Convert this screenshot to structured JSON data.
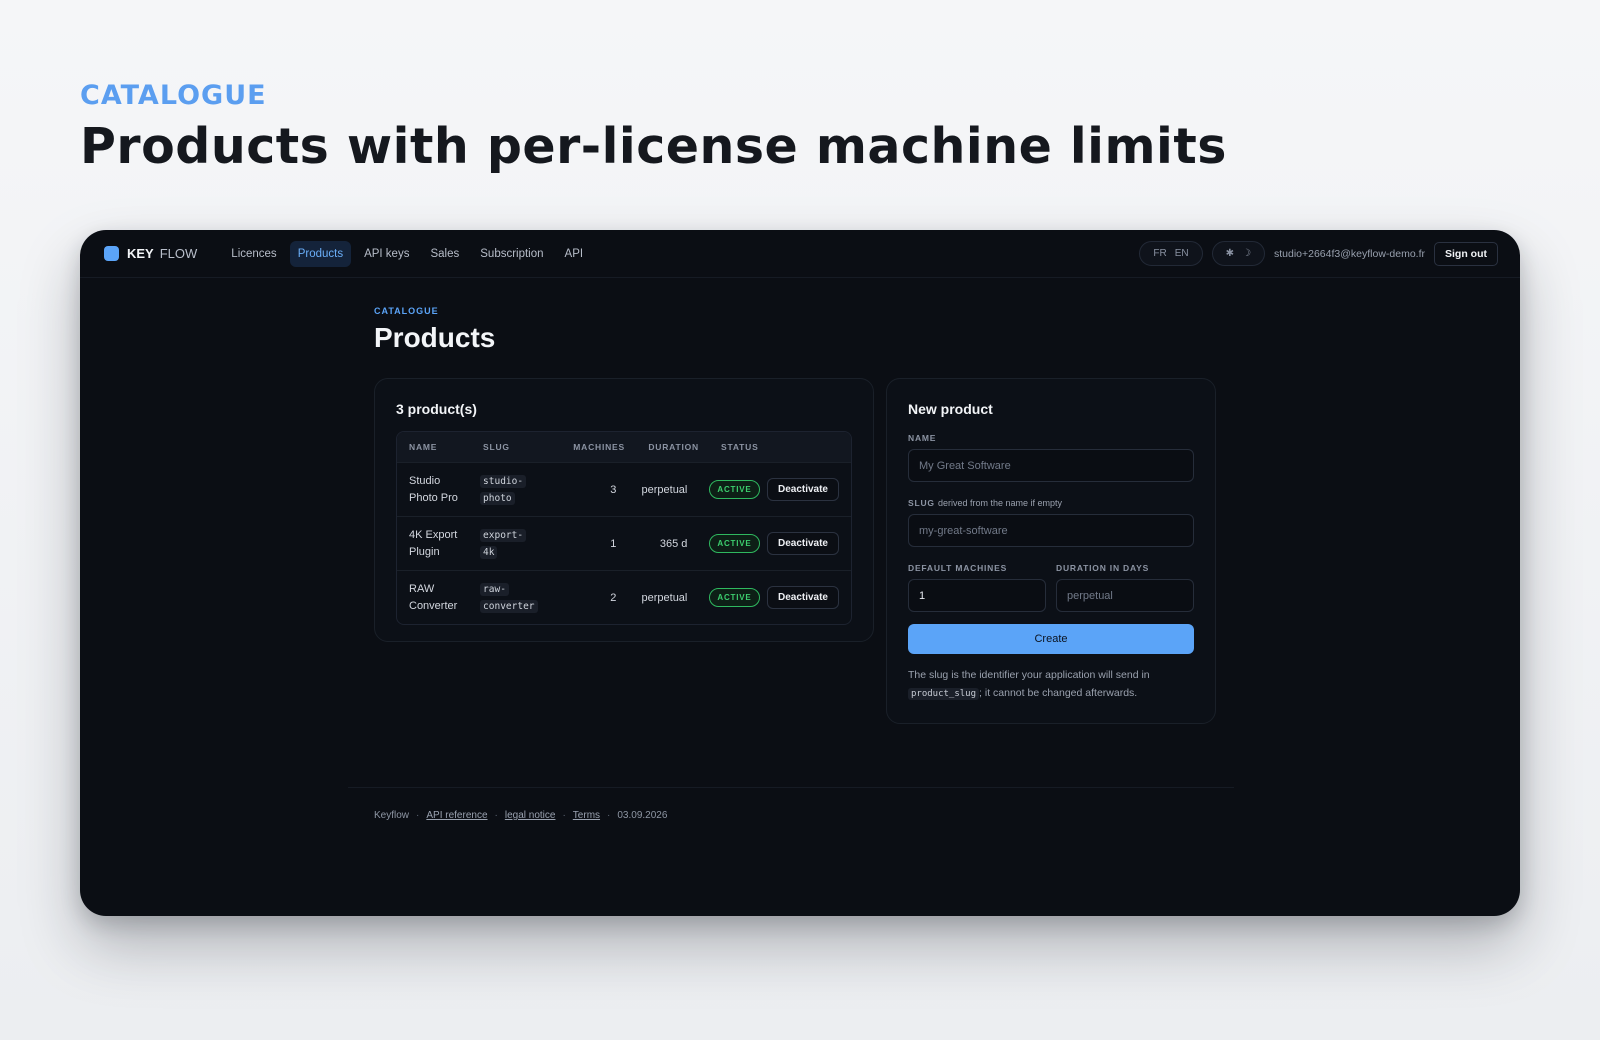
{
  "hero": {
    "eyebrow": "CATALOGUE",
    "title": "Products with per-license machine limits"
  },
  "app": {
    "logo_part1": "KEY",
    "logo_part2": "FLOW",
    "nav": [
      "Licences",
      "Products",
      "API keys",
      "Sales",
      "Subscription",
      "API"
    ],
    "active_nav": "Products",
    "lang": [
      "FR",
      "EN"
    ],
    "theme_icons": [
      "sun-icon",
      "moon-icon"
    ],
    "user_email": "studio+2664f3@keyflow-demo.fr",
    "sign_out": "Sign out"
  },
  "page": {
    "eyebrow": "CATALOGUE",
    "title": "Products"
  },
  "products": {
    "heading": "3 product(s)",
    "columns": [
      "NAME",
      "SLUG",
      "MACHINES",
      "DURATION",
      "STATUS"
    ],
    "rows": [
      {
        "name_1": "Studio",
        "name_2": "Photo Pro",
        "slug_1": "studio-",
        "slug_2": "photo",
        "machines": "3",
        "duration": "perpetual",
        "status": "ACTIVE",
        "action": "Deactivate"
      },
      {
        "name_1": "4K Export",
        "name_2": "Plugin",
        "slug_1": "export-",
        "slug_2": "4k",
        "machines": "1",
        "duration": "365 d",
        "status": "ACTIVE",
        "action": "Deactivate"
      },
      {
        "name_1": "RAW",
        "name_2": "Converter",
        "slug_1": "raw-",
        "slug_2": "converter",
        "machines": "2",
        "duration": "perpetual",
        "status": "ACTIVE",
        "action": "Deactivate"
      }
    ]
  },
  "form": {
    "heading": "New product",
    "name_label": "NAME",
    "name_placeholder": "My Great Software",
    "slug_label": "SLUG",
    "slug_hint": "derived from the name if empty",
    "slug_placeholder": "my-great-software",
    "machines_label": "DEFAULT MACHINES",
    "machines_value": "1",
    "duration_label": "DURATION IN DAYS",
    "duration_placeholder": "perpetual",
    "create": "Create",
    "note_before": "The slug is the identifier your application will send in",
    "note_code": "product_slug",
    "note_after": "; it cannot be changed afterwards."
  },
  "footer": {
    "brand": "Keyflow",
    "links": [
      "API reference",
      "legal notice",
      "Terms"
    ],
    "date": "03.09.2026"
  },
  "colors": {
    "accent": "#5ba4f8",
    "active_green": "#3ccf6e",
    "window_bg": "#0b0e14"
  }
}
